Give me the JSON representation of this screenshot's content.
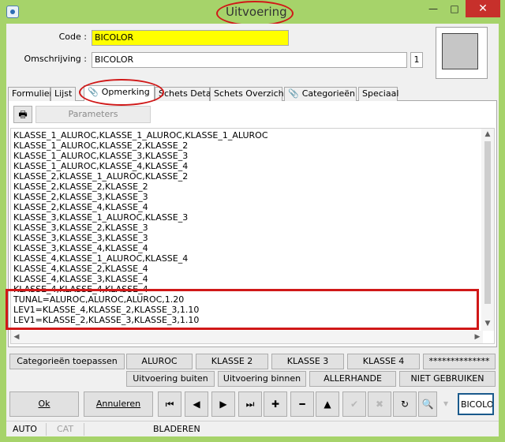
{
  "window": {
    "title": "Uitvoering",
    "minimize_glyph": "—",
    "maximize_glyph": "□",
    "close_glyph": "✕"
  },
  "header": {
    "code_label": "Code :",
    "code_value": "BICOLOR",
    "description_label": "Omschrijving :",
    "description_value": "BICOLOR",
    "description_count": "1"
  },
  "tabs": [
    {
      "label": "Formulier",
      "active": false
    },
    {
      "label": "Lijst",
      "active": false
    },
    {
      "label": "Opmerking",
      "active": true,
      "icon": "paperclip-icon"
    },
    {
      "label": "Schets Detail",
      "active": false
    },
    {
      "label": "Schets Overzicht",
      "active": false
    },
    {
      "label": "Categorieën",
      "active": false,
      "icon": "paperclip-icon"
    },
    {
      "label": "Speciaal",
      "active": false
    }
  ],
  "toolbar": {
    "print_icon": "printer-icon",
    "params_label": "Parameters"
  },
  "memo": {
    "lines": [
      "KLASSE_1_ALUROC,KLASSE_1_ALUROC,KLASSE_1_ALUROC",
      "KLASSE_1_ALUROC,KLASSE_2,KLASSE_2",
      "KLASSE_1_ALUROC,KLASSE_3,KLASSE_3",
      "KLASSE_1_ALUROC,KLASSE_4,KLASSE_4",
      "KLASSE_2,KLASSE_1_ALUROC,KLASSE_2",
      "KLASSE_2,KLASSE_2,KLASSE_2",
      "KLASSE_2,KLASSE_3,KLASSE_3",
      "KLASSE_2,KLASSE_4,KLASSE_4",
      "KLASSE_3,KLASSE_1_ALUROC,KLASSE_3",
      "KLASSE_3,KLASSE_2,KLASSE_3",
      "KLASSE_3,KLASSE_3,KLASSE_3",
      "KLASSE_3,KLASSE_4,KLASSE_4",
      "KLASSE_4,KLASSE_1_ALUROC,KLASSE_4",
      "KLASSE_4,KLASSE_2,KLASSE_4",
      "KLASSE_4,KLASSE_3,KLASSE_4",
      "KLASSE_4,KLASSE_4,KLASSE_4",
      "TUNAL=ALUROC,ALUROC,ALUROC,1.20",
      "LEV1=KLASSE_4,KLASSE_2,KLASSE_3,1.10",
      "LEV1=KLASSE_2,KLASSE_3,KLASSE_3,1.10"
    ]
  },
  "category_row": {
    "apply_label": "Categorieën toepassen",
    "buttons": [
      "ALUROC",
      "KLASSE 2",
      "KLASSE 3",
      "KLASSE 4",
      "**************"
    ]
  },
  "second_row": {
    "buttons": [
      "Uitvoering buiten",
      "Uitvoering binnen",
      "ALLERHANDE",
      "NIET GEBRUIKEN"
    ]
  },
  "footer": {
    "ok_label": "Ok",
    "cancel_label": "Annuleren",
    "search_value": "BICOLOR",
    "nav": {
      "first": "⏮",
      "prev": "◀",
      "next": "▶",
      "last": "⏭",
      "add": "✚",
      "remove": "━",
      "up": "▲",
      "confirm": "✔",
      "discard": "✖",
      "refresh": "↻",
      "find": "🔍",
      "dropdown": "▾"
    }
  },
  "status": {
    "mode1": "AUTO",
    "mode2": "CAT",
    "mode3": "BLADEREN"
  }
}
